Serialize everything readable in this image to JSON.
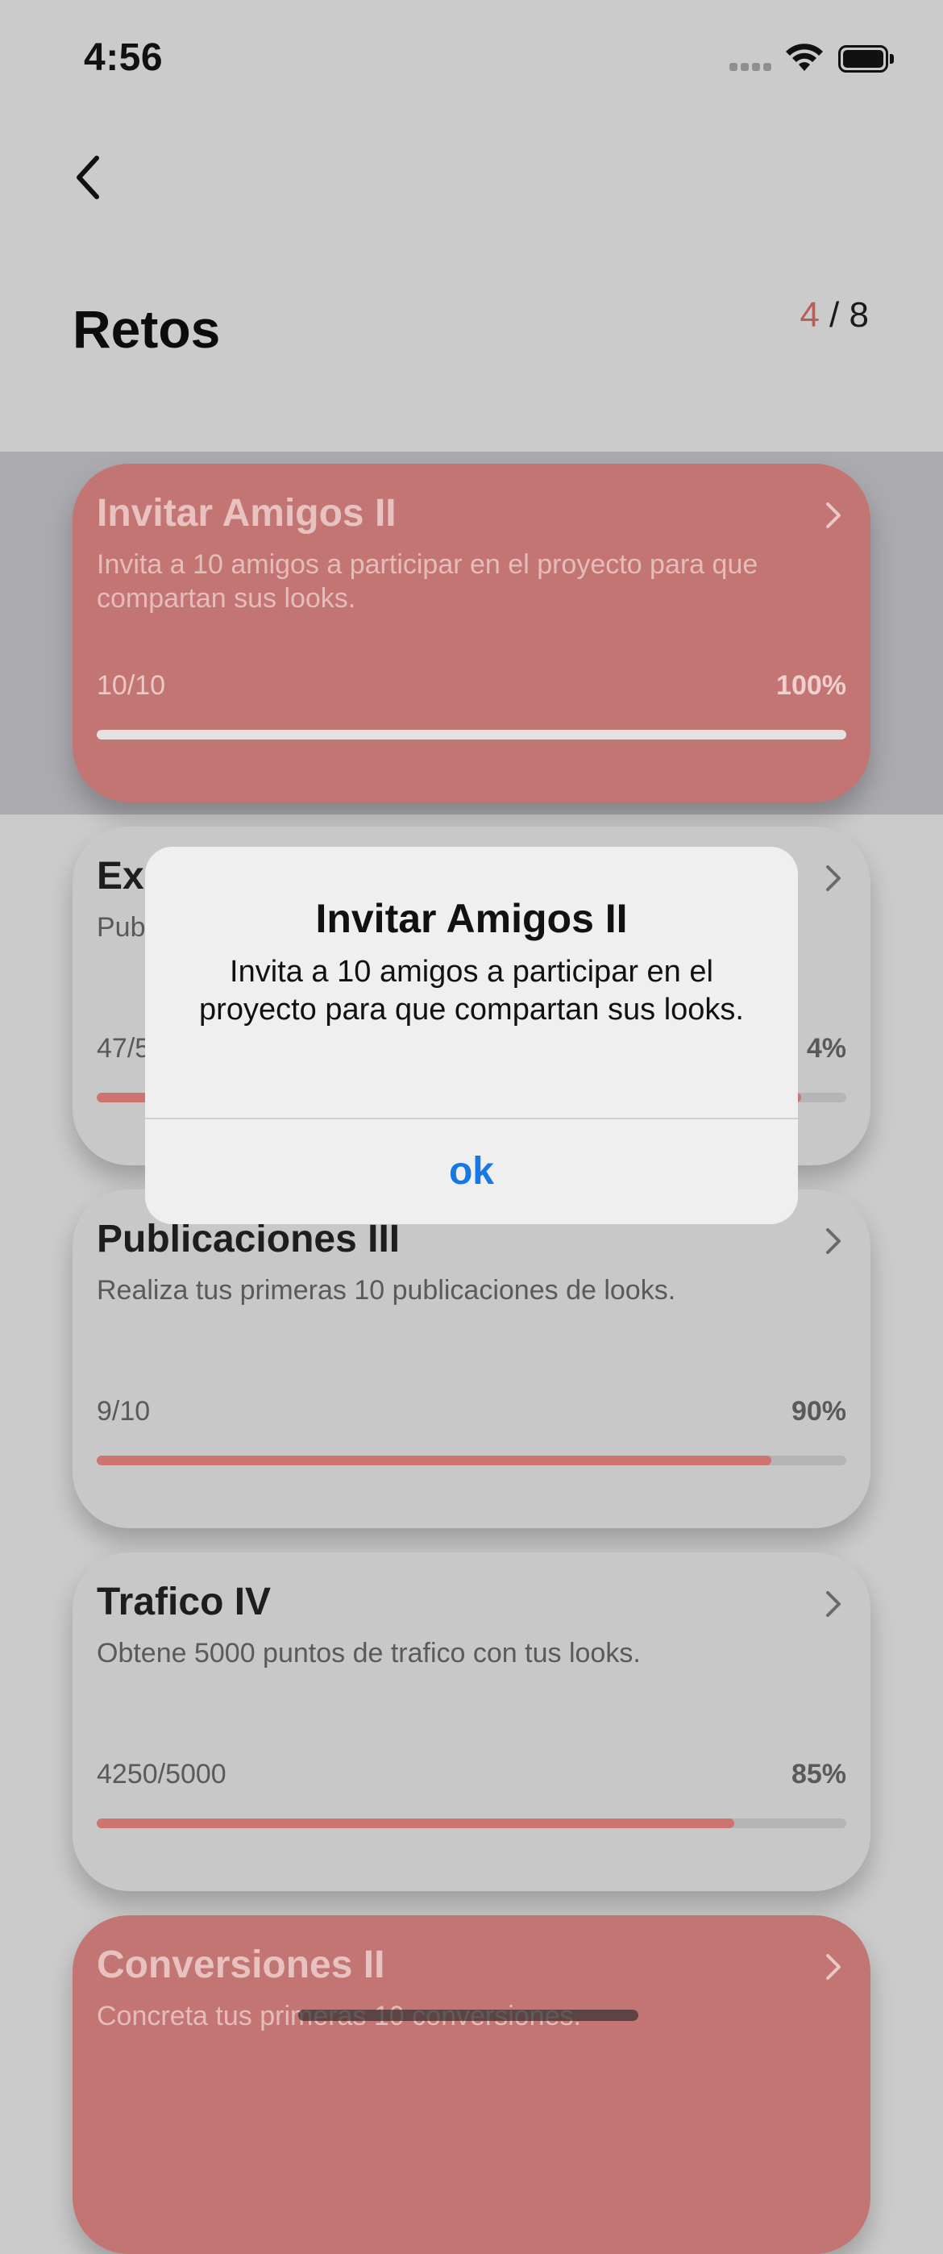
{
  "status_bar": {
    "time": "4:56"
  },
  "header": {
    "title": "Retos",
    "counter_current": "4",
    "counter_sep": "/",
    "counter_total": "8"
  },
  "cards": [
    {
      "title": "Invitar Amigos II",
      "description": "Invita a 10 amigos a participar en el proyecto para que compartan sus looks.",
      "progress": "10/10",
      "percent": "100%",
      "fill_fraction": 1.0,
      "completed": true
    },
    {
      "title": "Exp",
      "description": "Pub",
      "progress": "47/5",
      "percent": "4%",
      "fill_fraction": 0.94,
      "completed": false
    },
    {
      "title": "Publicaciones III",
      "description": "Realiza tus primeras 10 publicaciones de looks.",
      "progress": "9/10",
      "percent": "90%",
      "fill_fraction": 0.9,
      "completed": false
    },
    {
      "title": "Trafico IV",
      "description": "Obtene 5000 puntos de trafico con tus looks.",
      "progress": "4250/5000",
      "percent": "85%",
      "fill_fraction": 0.85,
      "completed": false
    },
    {
      "title": "Conversiones II",
      "description": "Concreta tus primeras 10 conversiones.",
      "progress": "",
      "percent": "",
      "fill_fraction": 0,
      "completed": true
    }
  ],
  "alert": {
    "title": "Invitar Amigos II",
    "message": "Invita a 10 amigos a participar en el proyecto para que compartan sus looks.",
    "button": "ok"
  },
  "colors": {
    "accent": "#cd7370",
    "completed_card": "#c27573",
    "alert_button": "#1677e6"
  },
  "icons": {
    "back": "chevron-left-icon",
    "card_arrow": "chevron-right-icon",
    "wifi": "wifi-icon",
    "battery": "battery-icon",
    "signal": "cellular-signal-icon"
  }
}
